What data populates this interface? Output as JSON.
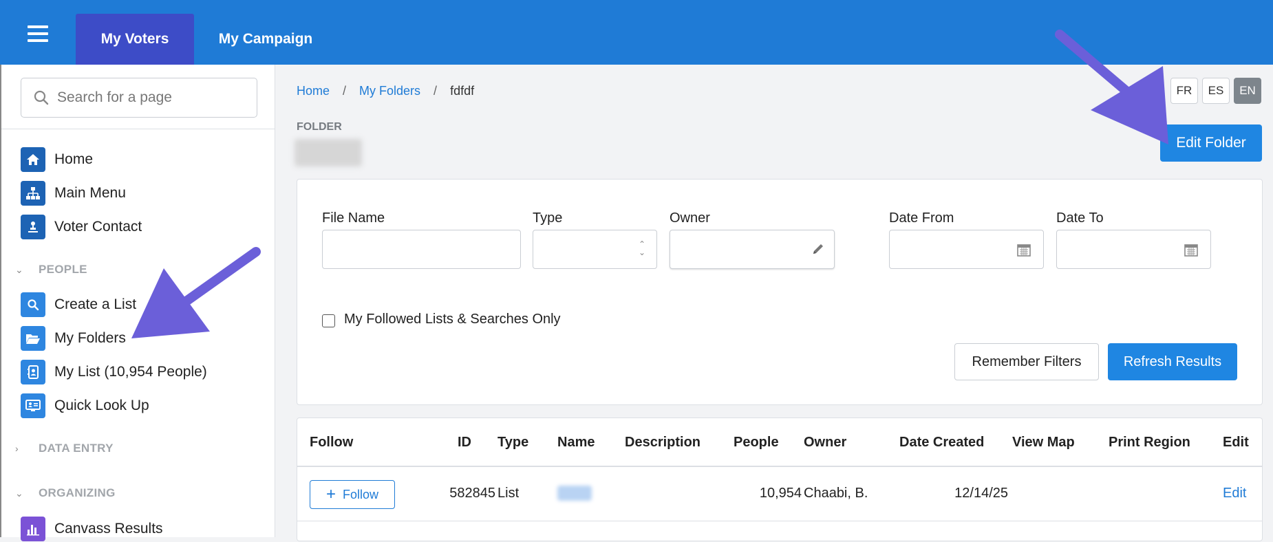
{
  "topbar": {
    "tabs": [
      {
        "label": "My Voters",
        "active": true
      },
      {
        "label": "My Campaign",
        "active": false
      }
    ]
  },
  "sidebar": {
    "search_placeholder": "Search for a page",
    "items": [
      {
        "label": "Home",
        "icon": "home-icon"
      },
      {
        "label": "Main Menu",
        "icon": "sitemap-icon"
      },
      {
        "label": "Voter Contact",
        "icon": "contact-icon"
      }
    ],
    "sections": [
      {
        "label": "PEOPLE",
        "expanded": true
      },
      {
        "label": "DATA ENTRY",
        "expanded": false
      },
      {
        "label": "ORGANIZING",
        "expanded": true
      }
    ],
    "people_items": [
      {
        "label": "Create a List",
        "icon": "search-icon"
      },
      {
        "label": "My Folders",
        "icon": "folder-open-icon"
      },
      {
        "label": "My List (10,954 People)",
        "icon": "address-book-icon"
      },
      {
        "label": "Quick Look Up",
        "icon": "id-card-icon"
      }
    ],
    "organizing_items": [
      {
        "label": "Canvass Results",
        "icon": "bar-chart-icon"
      }
    ]
  },
  "breadcrumb": {
    "home": "Home",
    "sep": "/",
    "folders": "My Folders",
    "current": "fdfdf"
  },
  "languages": [
    {
      "code": "FR",
      "active": false
    },
    {
      "code": "ES",
      "active": false
    },
    {
      "code": "EN",
      "active": true
    }
  ],
  "folder": {
    "label": "FOLDER",
    "edit_button": "Edit Folder"
  },
  "filters": {
    "file_name_label": "File Name",
    "type_label": "Type",
    "owner_label": "Owner",
    "date_from_label": "Date From",
    "date_to_label": "Date To",
    "followed_only_label": "My Followed Lists & Searches Only",
    "remember_button": "Remember Filters",
    "refresh_button": "Refresh Results"
  },
  "table": {
    "headers": [
      "Follow",
      "ID",
      "Type",
      "Name",
      "Description",
      "People",
      "Owner",
      "Date Created",
      "View Map",
      "Print Region",
      "Edit"
    ],
    "rows": [
      {
        "follow": "Follow",
        "id": "582845",
        "type": "List",
        "description": "",
        "people": "10,954",
        "owner": "Chaabi, B.",
        "date_created": "12/14/25",
        "edit": "Edit"
      }
    ]
  },
  "colors": {
    "topbar": "#1f7bd6",
    "active_tab": "#3d4cc7",
    "primary_button": "#1f86e2",
    "annotation_arrow": "#6b5fd9"
  }
}
